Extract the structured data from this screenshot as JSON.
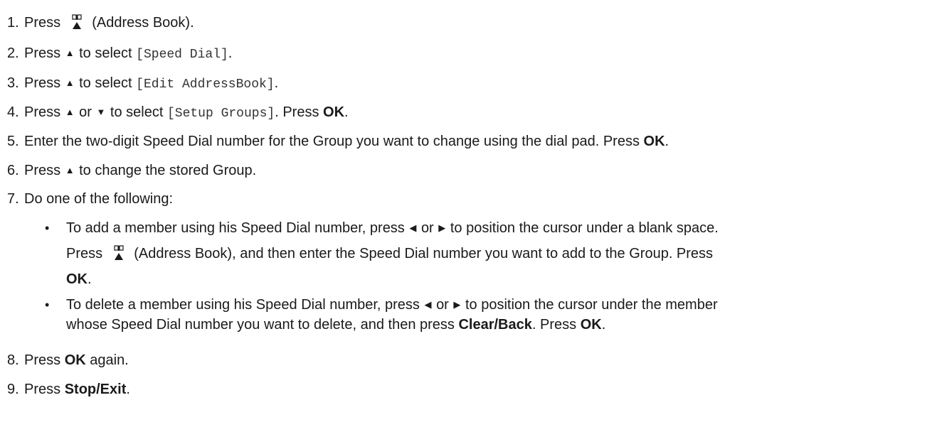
{
  "steps": [
    {
      "num": "1.",
      "pre": "Press",
      "post": "(Address Book)."
    },
    {
      "num": "2.",
      "pre": "Press",
      "arrow": "▲",
      "mid": "to select",
      "code": "[Speed Dial]",
      "post": "."
    },
    {
      "num": "3.",
      "pre": "Press",
      "arrow": "▲",
      "mid": "to select",
      "code": "[Edit AddressBook]",
      "post": "."
    },
    {
      "num": "4.",
      "pre": "Press",
      "arrow1": "▲",
      "or": "or",
      "arrow2": "▼",
      "mid": "to select",
      "code": "[Setup Groups]",
      "post": ". Press",
      "bold": "OK",
      "end": "."
    },
    {
      "num": "5.",
      "pre": "Enter the two-digit Speed Dial number for the Group you want to change using the dial pad. Press",
      "bold": "OK",
      "end": "."
    },
    {
      "num": "6.",
      "pre": "Press",
      "arrow": "▲",
      "post": "to change the stored Group."
    },
    {
      "num": "7.",
      "pre": "Do one of the following:"
    },
    {
      "num": "8.",
      "pre": "Press",
      "bold": "OK",
      "post": "again."
    },
    {
      "num": "9.",
      "pre": "Press",
      "bold": "Stop/Exit",
      "end": "."
    }
  ],
  "bullets": [
    {
      "bullet": "•",
      "line1_pre": "To add a member using his Speed Dial number, press",
      "left_arrow": "◀",
      "or": "or",
      "right_arrow": "▶",
      "line1_post": "to position the cursor under a blank space.",
      "line2_pre": "Press",
      "line2_post": "(Address Book), and then enter the Speed Dial number you want to add to the Group. Press",
      "line3_bold": "OK",
      "line3_end": "."
    },
    {
      "bullet": "•",
      "line1_pre": "To delete a member using his Speed Dial number, press",
      "left_arrow": "◀",
      "or": "or",
      "right_arrow": "▶",
      "line1_post": "to position the cursor under the member",
      "line2_pre": "whose Speed Dial number you want to delete, and then press",
      "line2_bold1": "Clear/Back",
      "line2_mid": ". Press",
      "line2_bold2": "OK",
      "line2_end": "."
    }
  ]
}
